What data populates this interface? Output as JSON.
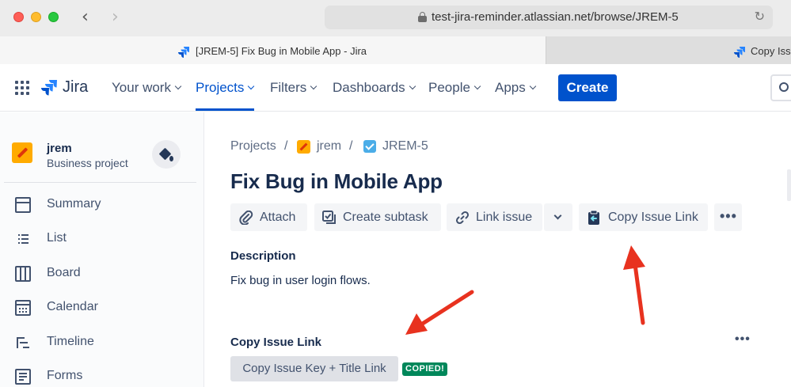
{
  "browser": {
    "url": "test-jira-reminder.atlassian.net/browse/JREM-5",
    "tabs": [
      {
        "title": "[JREM-5] Fix Bug in Mobile App - Jira",
        "active": true
      },
      {
        "title": "Copy Issu",
        "active": false
      }
    ]
  },
  "topnav": {
    "product": "Jira",
    "items": [
      {
        "label": "Your work"
      },
      {
        "label": "Projects"
      },
      {
        "label": "Filters"
      },
      {
        "label": "Dashboards"
      },
      {
        "label": "People"
      },
      {
        "label": "Apps"
      }
    ],
    "active_item": "Projects",
    "create_label": "Create"
  },
  "sidebar": {
    "project_name": "jrem",
    "project_type": "Business project",
    "items": [
      {
        "label": "Summary",
        "icon": "summary-icon"
      },
      {
        "label": "List",
        "icon": "list-icon"
      },
      {
        "label": "Board",
        "icon": "board-icon"
      },
      {
        "label": "Calendar",
        "icon": "calendar-icon"
      },
      {
        "label": "Timeline",
        "icon": "timeline-icon"
      },
      {
        "label": "Forms",
        "icon": "forms-icon"
      }
    ]
  },
  "breadcrumb": {
    "projects": "Projects",
    "project": "jrem",
    "issue_key": "JREM-5",
    "separator": "/"
  },
  "issue": {
    "title": "Fix Bug in Mobile App",
    "actions": {
      "attach": "Attach",
      "create_subtask": "Create subtask",
      "link_issue": "Link issue",
      "copy_issue_link": "Copy Issue Link",
      "more": "•••"
    },
    "description_label": "Description",
    "description_text": "Fix bug in user login flows."
  },
  "copy_panel": {
    "label": "Copy Issue Link",
    "more": "•••",
    "button_label": "Copy Issue Key + Title Link",
    "badge": "COPIED!"
  },
  "colors": {
    "brand_blue": "#0052CC",
    "badge_green": "#00875A",
    "annotation_red": "#E8321F"
  }
}
